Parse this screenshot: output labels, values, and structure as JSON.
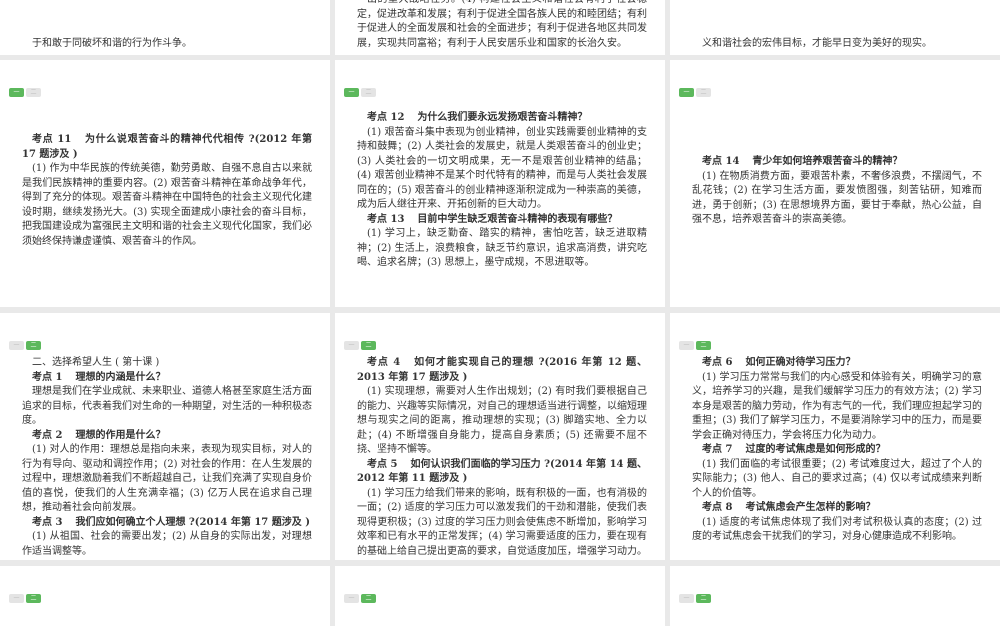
{
  "panels": [
    {
      "id": "p-0-0",
      "buttons": [],
      "paragraphs": [
        {
          "type": "body",
          "text": "于和敢于同破坏和谐的行为作斗争。"
        }
      ]
    },
    {
      "id": "p-0-1",
      "buttons": [],
      "paragraphs": [
        {
          "type": "body",
          "text": "出的重大战略任务。(4) 构建社会主义和谐社会有利于社会稳定，促进改革和发展；有利于促进全国各族人民的和睦团结；有利于促进人的全面发展和社会的全面进步；有利于促进各地区共同发展，实现共同富裕；有利于人民安居乐业和国家的长治久安。"
        }
      ]
    },
    {
      "id": "p-0-2",
      "buttons": [],
      "paragraphs": [
        {
          "type": "body",
          "text": "义和谐社会的宏伟目标，才能早日变为美好的现实。"
        }
      ]
    },
    {
      "id": "p-1-0",
      "buttons": [
        {
          "label": "一",
          "active": true
        },
        {
          "label": "二",
          "active": false
        }
      ],
      "paragraphs": [
        {
          "type": "heading",
          "num": "考点 11",
          "text": "为什么说艰苦奋斗的精神代代相传 ?(2012 年第 17 题涉及 )"
        },
        {
          "type": "body",
          "text": "(1) 作为中华民族的传统美德，勤劳勇敢、自强不息自古以来就是我们民族精神的重要内容。(2) 艰苦奋斗精神在革命战争年代，得到了充分的体现。艰苦奋斗精神在中国特色的社会主义现代化建设时期，继续发扬光大。(3) 实现全面建成小康社会的奋斗目标，把我国建设成为富强民主文明和谐的社会主义现代化国家，我们必须始终保持谦虚谨慎、艰苦奋斗的作风。"
        }
      ]
    },
    {
      "id": "p-1-1",
      "buttons": [
        {
          "label": "一",
          "active": true
        },
        {
          "label": "二",
          "active": false
        }
      ],
      "paragraphs": [
        {
          "type": "heading",
          "num": "考点 12",
          "text": "为什么我们要永远发扬艰苦奋斗精神？"
        },
        {
          "type": "body",
          "text": "(1) 艰苦奋斗集中表现为创业精神，创业实践需要创业精神的支持和鼓舞；(2) 人类社会的发展史，就是人类艰苦奋斗的创业史；(3) 人类社会的一切文明成果，无一不是艰苦创业精神的结晶；(4) 艰苦创业精神不是某个时代特有的精神，而是与人类社会发展同在的；(5) 艰苦奋斗的创业精神逐渐积淀成为一种崇高的美德，成为后人继往开来、开拓创新的巨大动力。"
        },
        {
          "type": "heading",
          "num": "考点 13",
          "text": "目前中学生缺乏艰苦奋斗精神的表现有哪些？"
        },
        {
          "type": "body",
          "text": "(1) 学习上，缺乏勤奋、踏实的精神，害怕吃苦，缺乏进取精神；(2) 生活上，浪费粮食，缺乏节约意识，追求高消费，讲究吃喝、追求名牌；(3) 思想上，墨守成规，不思进取等。"
        }
      ]
    },
    {
      "id": "p-1-2",
      "buttons": [
        {
          "label": "一",
          "active": true
        },
        {
          "label": "二",
          "active": false
        }
      ],
      "paragraphs": [
        {
          "type": "heading",
          "num": "考点 14",
          "text": "青少年如何培养艰苦奋斗的精神？"
        },
        {
          "type": "body",
          "text": "(1) 在物质消费方面，要艰苦朴素，不奢侈浪费，不摆阔气，不乱花钱；(2) 在学习生活方面，要发愤图强，刻苦钻研，知难而进，勇于创新；(3) 在思想境界方面，要甘于奉献，热心公益，自强不息，培养艰苦奋斗的崇高美德。"
        }
      ]
    },
    {
      "id": "p-2-0",
      "buttons": [
        {
          "label": "一",
          "active": false
        },
        {
          "label": "二",
          "active": true
        }
      ],
      "paragraphs": [
        {
          "type": "sub",
          "text": "二、选择希望人生 ( 第十课 )"
        },
        {
          "type": "heading",
          "num": "考点 1",
          "text": "理想的内涵是什么？"
        },
        {
          "type": "body",
          "text": "理想是我们在学业成就、未来职业、道德人格甚至家庭生活方面追求的目标，代表着我们对生命的一种期望，对生活的一种积极态度。"
        },
        {
          "type": "heading",
          "num": "考点 2",
          "text": "理想的作用是什么？"
        },
        {
          "type": "body",
          "text": "(1) 对人的作用：理想总是指向未来，表现为现实目标，对人的行为有导向、驱动和调控作用；(2) 对社会的作用：在人生发展的过程中，理想激励着我们不断超越自己，让我们充满了实现自身价值的喜悦，使我们的人生充满幸福；(3) 亿万人民在追求自己理想，推动着社会向前发展。"
        },
        {
          "type": "heading",
          "num": "考点 3",
          "text": "我们应如何确立个人理想 ?(2014 年第 17 题涉及 )"
        },
        {
          "type": "body",
          "text": "(1) 从祖国、社会的需要出发；(2) 从自身的实际出发，对理想作适当调整等。"
        }
      ]
    },
    {
      "id": "p-2-1",
      "buttons": [
        {
          "label": "一",
          "active": false
        },
        {
          "label": "二",
          "active": true
        }
      ],
      "paragraphs": [
        {
          "type": "heading",
          "num": "考点 4",
          "text": "如何才能实现自己的理想 ?(2016 年第 12 题、2013 年第 17 题涉及 )"
        },
        {
          "type": "body",
          "text": "(1) 实现理想，需要对人生作出规划；(2) 有时我们要根据自己的能力、兴趣等实际情况，对自己的理想适当进行调整，以缩短理想与现实之间的距离，推动理想的实现；(3) 脚踏实地、全力以赴；(4) 不断增强自身能力，提高自身素质；(5) 还需要不屈不挠、坚持不懈等。"
        },
        {
          "type": "heading",
          "num": "考点 5",
          "text": "如何认识我们面临的学习压力 ?(2014 年第 14 题、2012 年第 11 题涉及 )"
        },
        {
          "type": "body",
          "text": "(1) 学习压力给我们带来的影响，既有积极的一面，也有消极的一面；(2) 适度的学习压力可以激发我们的干劲和潜能，使我们表现得更积极；(3) 过度的学习压力则会使焦虑不断增加，影响学习效率和已有水平的正常发挥；(4) 学习需要适度的压力，要在现有的基础上给自己提出更高的要求，自觉适度加压，增强学习动力。"
        }
      ]
    },
    {
      "id": "p-2-2",
      "buttons": [
        {
          "label": "一",
          "active": false
        },
        {
          "label": "二",
          "active": true
        }
      ],
      "paragraphs": [
        {
          "type": "heading",
          "num": "考点 6",
          "text": "如何正确对待学习压力？"
        },
        {
          "type": "body",
          "text": "(1) 学习压力常常与我们的内心感受和体验有关，明确学习的意义，培养学习的兴趣，是我们缓解学习压力的有效方法；(2) 学习本身是艰苦的脑力劳动，作为有志气的一代，我们理应担起学习的重担；(3) 我们了解学习压力，不是要消除学习中的压力，而是要学会正确对待压力，学会将压力化为动力。"
        },
        {
          "type": "heading",
          "num": "考点 7",
          "text": "过度的考试焦虑是如何形成的？"
        },
        {
          "type": "body",
          "text": "(1) 我们面临的考试很重要；(2) 考试难度过大，超过了个人的实际能力；(3) 他人、自己的要求过高；(4) 仅以考试成绩来判断个人的价值等。"
        },
        {
          "type": "heading",
          "num": "考点 8",
          "text": "考试焦虑会产生怎样的影响？"
        },
        {
          "type": "body",
          "text": "(1) 适度的考试焦虑体现了我们对考试积极认真的态度；(2) 过度的考试焦虑会干扰我们的学习，对身心健康造成不利影响。"
        }
      ]
    },
    {
      "id": "p-3-0",
      "buttons": [
        {
          "label": "一",
          "active": false
        },
        {
          "label": "二",
          "active": true
        }
      ],
      "paragraphs": []
    },
    {
      "id": "p-3-1",
      "buttons": [
        {
          "label": "一",
          "active": false
        },
        {
          "label": "二",
          "active": true
        }
      ],
      "paragraphs": []
    },
    {
      "id": "p-3-2",
      "buttons": [
        {
          "label": "一",
          "active": false
        },
        {
          "label": "二",
          "active": true
        }
      ],
      "paragraphs": []
    }
  ]
}
